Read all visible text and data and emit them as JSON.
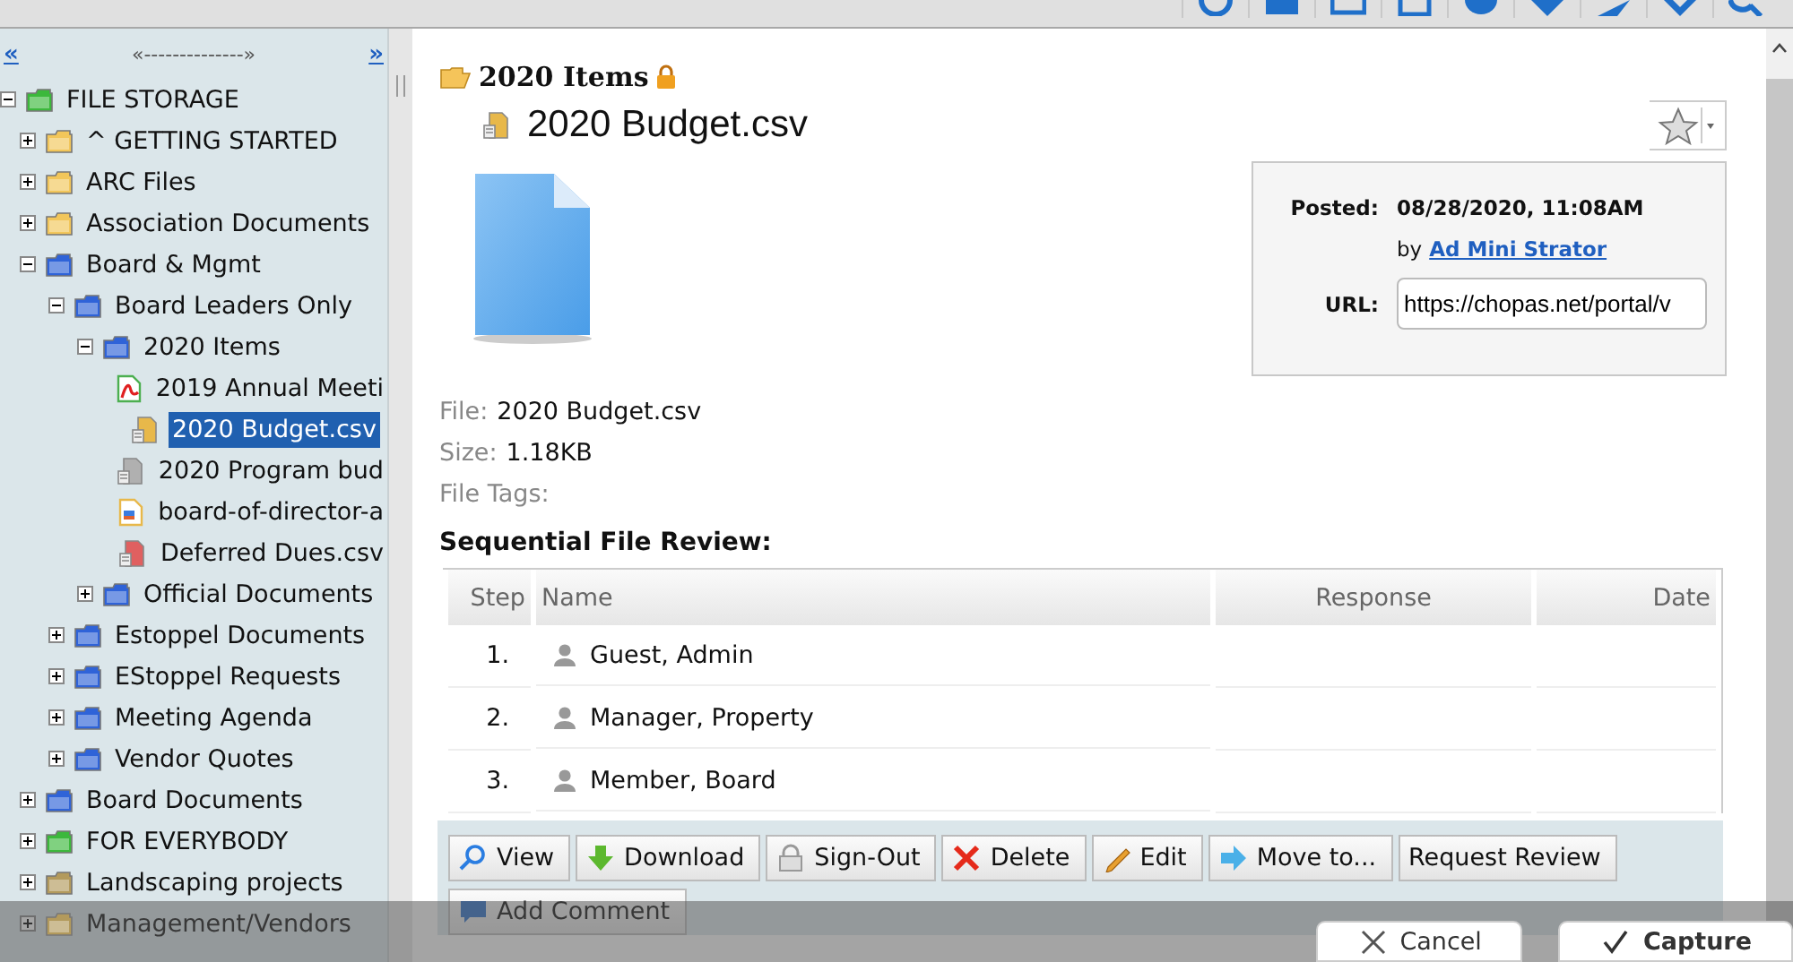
{
  "sidebar": {
    "nav_first": "«",
    "nav_resize": "«--------------»",
    "nav_last": "»",
    "tree": [
      {
        "label": "FILE STORAGE",
        "kind": "folder",
        "color": "#3cb83c",
        "expanded": true,
        "selected": false,
        "children": [
          {
            "label": "^ GETTING STARTED",
            "kind": "folder",
            "color": "#f2c65a",
            "expanded": false,
            "selected": false
          },
          {
            "label": "ARC Files",
            "kind": "folder",
            "color": "#f2c65a",
            "expanded": false,
            "selected": false
          },
          {
            "label": "Association Documents",
            "kind": "folder",
            "color": "#f2c65a",
            "expanded": false,
            "selected": false
          },
          {
            "label": "Board & Mgmt",
            "kind": "folder",
            "color": "#2f63d8",
            "expanded": true,
            "selected": false,
            "children": [
              {
                "label": "Board Leaders Only",
                "kind": "folder",
                "color": "#2f63d8",
                "expanded": true,
                "selected": false,
                "children": [
                  {
                    "label": "2020 Items",
                    "kind": "folder",
                    "color": "#2f63d8",
                    "expanded": true,
                    "selected": false,
                    "children": [
                      {
                        "label": "2019 Annual Meeti",
                        "kind": "pdf",
                        "color": "#4caf50",
                        "selected": false
                      },
                      {
                        "label": "2020 Budget.csv",
                        "kind": "sheet",
                        "color": "#e8b84a",
                        "selected": true
                      },
                      {
                        "label": "2020 Program bud",
                        "kind": "sheet",
                        "color": "#b0b0b0",
                        "selected": false
                      },
                      {
                        "label": "board-of-director-a",
                        "kind": "doc",
                        "color": "#e8b84a",
                        "selected": false
                      },
                      {
                        "label": "Deferred Dues.csv",
                        "kind": "sheet",
                        "color": "#e06060",
                        "selected": false
                      }
                    ]
                  },
                  {
                    "label": "Official Documents",
                    "kind": "folder",
                    "color": "#2f63d8",
                    "expanded": false,
                    "selected": false
                  }
                ]
              },
              {
                "label": "Estoppel Documents",
                "kind": "folder",
                "color": "#2f63d8",
                "expanded": false,
                "selected": false
              },
              {
                "label": "EStoppel Requests",
                "kind": "folder",
                "color": "#2f63d8",
                "expanded": false,
                "selected": false
              },
              {
                "label": "Meeting Agenda",
                "kind": "folder",
                "color": "#2f63d8",
                "expanded": false,
                "selected": false
              },
              {
                "label": "Vendor Quotes",
                "kind": "folder",
                "color": "#2f63d8",
                "expanded": false,
                "selected": false
              }
            ]
          },
          {
            "label": "Board Documents",
            "kind": "folder",
            "color": "#2f63d8",
            "expanded": false,
            "selected": false
          },
          {
            "label": "FOR EVERYBODY",
            "kind": "folder",
            "color": "#3cb83c",
            "expanded": false,
            "selected": false
          },
          {
            "label": "Landscaping projects",
            "kind": "folder",
            "color": "#b39a5c",
            "expanded": false,
            "selected": false
          },
          {
            "label": "Management/Vendors",
            "kind": "folder",
            "color": "#b39a5c",
            "expanded": false,
            "selected": false
          }
        ]
      }
    ]
  },
  "main": {
    "folder_title": "2020 Items",
    "locked": true,
    "file_title": "2020 Budget.csv",
    "info": {
      "posted_label": "Posted:",
      "posted_value": "08/28/2020, 11:08AM",
      "by": "by",
      "author": "Ad Mini Strator",
      "url_label": "URL:",
      "url_value": "https://chopas.net/portal/v"
    },
    "fields": [
      {
        "label": "File:",
        "value": "2020 Budget.csv"
      },
      {
        "label": "Size:",
        "value": "1.18KB"
      },
      {
        "label": "File Tags:"
      }
    ],
    "review_title": "Sequential File Review:",
    "table": {
      "columns": [
        "Step",
        "Name",
        "Response",
        "Date"
      ],
      "rows": [
        {
          "step": "1.",
          "name": "Guest, Admin"
        },
        {
          "step": "2.",
          "name": "Manager, Property"
        },
        {
          "step": "3.",
          "name": "Member, Board"
        }
      ]
    },
    "actions": [
      {
        "label": "View",
        "kind": "view"
      },
      {
        "label": "Download",
        "kind": "download"
      },
      {
        "label": "Sign-Out",
        "kind": "signout"
      },
      {
        "label": "Delete",
        "kind": "delete"
      },
      {
        "label": "Edit",
        "kind": "edit"
      },
      {
        "label": "Move to...",
        "kind": "move"
      },
      {
        "label": "Request Review",
        "kind": "plain"
      }
    ],
    "add_comment": "Add Comment"
  },
  "dialog_buttons": [
    {
      "label": "Cancel",
      "kind": "cancel"
    },
    {
      "label": "Capture",
      "kind": "confirm"
    }
  ]
}
